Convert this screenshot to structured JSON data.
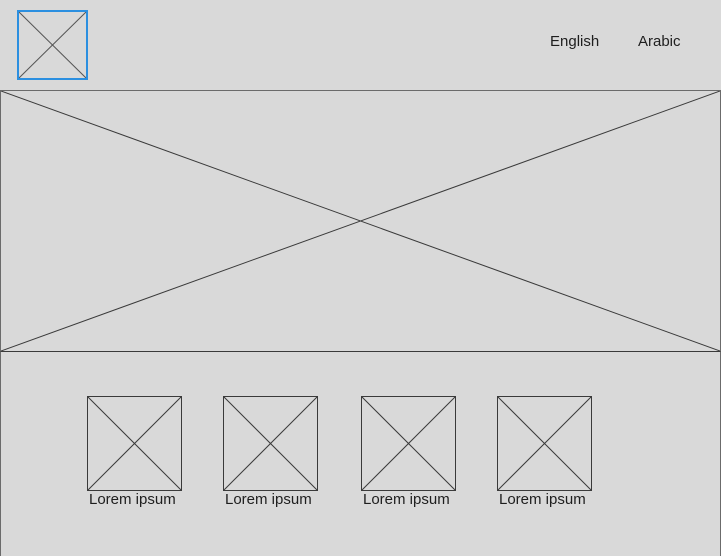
{
  "header": {
    "logo_icon": "image-placeholder-icon",
    "languages": [
      "English",
      "Arabic"
    ]
  },
  "hero": {
    "icon": "image-placeholder-icon"
  },
  "cards": [
    {
      "caption": "Lorem ipsum",
      "icon": "image-placeholder-icon"
    },
    {
      "caption": "Lorem ipsum",
      "icon": "image-placeholder-icon"
    },
    {
      "caption": "Lorem ipsum",
      "icon": "image-placeholder-icon"
    },
    {
      "caption": "Lorem ipsum",
      "icon": "image-placeholder-icon"
    }
  ],
  "colors": {
    "background": "#d9d9d9",
    "selection_border": "#2b8fe0",
    "line": "#3a3a3a"
  }
}
